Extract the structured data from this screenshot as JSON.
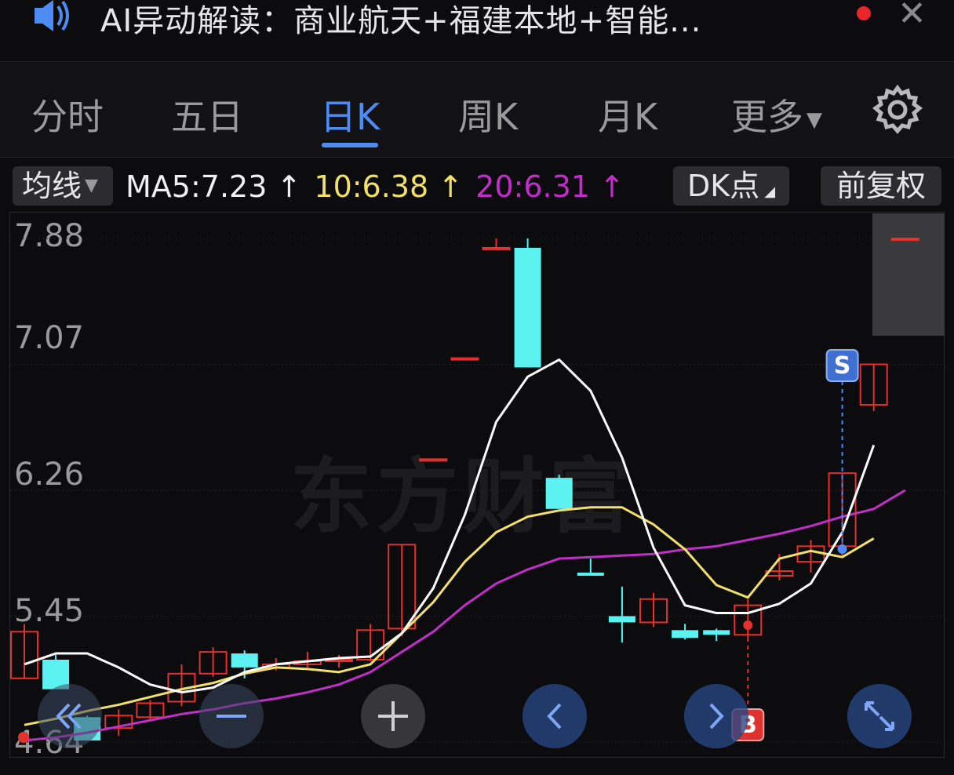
{
  "header": {
    "title": "AI异动解读：商业航天+福建本地+智能...",
    "speaker_icon": "speaker-icon",
    "close_icon": "close-icon",
    "notification_color": "#e8262c"
  },
  "tabs": [
    {
      "label": "分时",
      "active": false
    },
    {
      "label": "五日",
      "active": false
    },
    {
      "label": "日K",
      "active": true
    },
    {
      "label": "周K",
      "active": false
    },
    {
      "label": "月K",
      "active": false
    },
    {
      "label": "更多",
      "active": false
    }
  ],
  "toolbar": {
    "ma_selector": "均线",
    "ma5": "MA5:7.23 ↑",
    "ma10": "10:6.38 ↑",
    "ma20": "20:6.31 ↑",
    "dk_button": "DK点",
    "adjust_button": "前复权"
  },
  "colors": {
    "up": "#e0322f",
    "down": "#5df2f2",
    "ma5": "#ffffff",
    "ma10": "#f2e06a",
    "ma20": "#c02fc8",
    "accent": "#4d8cf5"
  },
  "chart": {
    "y_labels": [
      "7.88",
      "7.07",
      "6.26",
      "5.45",
      "4.64"
    ],
    "watermark": "东方财富",
    "signal_sell": "S",
    "signal_buy": "B"
  },
  "chart_data": {
    "type": "candlestick",
    "ylim": [
      4.64,
      7.88
    ],
    "y_ticks": [
      7.88,
      7.07,
      6.26,
      5.45,
      4.64
    ],
    "candles": [
      {
        "o": 5.05,
        "c": 5.35,
        "h": 5.4,
        "l": 5.05,
        "dir": "up"
      },
      {
        "o": 5.17,
        "c": 4.98,
        "h": 5.2,
        "l": 4.98,
        "dir": "down"
      },
      {
        "o": 4.8,
        "c": 4.65,
        "h": 4.81,
        "l": 4.65,
        "dir": "down"
      },
      {
        "o": 4.73,
        "c": 4.81,
        "h": 4.85,
        "l": 4.68,
        "dir": "up"
      },
      {
        "o": 4.8,
        "c": 4.89,
        "h": 4.91,
        "l": 4.78,
        "dir": "up"
      },
      {
        "o": 4.9,
        "c": 5.08,
        "h": 5.14,
        "l": 4.87,
        "dir": "up"
      },
      {
        "o": 5.08,
        "c": 5.22,
        "h": 5.25,
        "l": 5.06,
        "dir": "up"
      },
      {
        "o": 5.21,
        "c": 5.12,
        "h": 5.23,
        "l": 5.05,
        "dir": "down"
      },
      {
        "o": 5.12,
        "c": 5.14,
        "h": 5.18,
        "l": 5.1,
        "dir": "up"
      },
      {
        "o": 5.14,
        "c": 5.16,
        "h": 5.22,
        "l": 5.12,
        "dir": "up"
      },
      {
        "o": 5.16,
        "c": 5.17,
        "h": 5.2,
        "l": 5.12,
        "dir": "up"
      },
      {
        "o": 5.17,
        "c": 5.36,
        "h": 5.4,
        "l": 5.16,
        "dir": "up"
      },
      {
        "o": 5.37,
        "c": 5.91,
        "h": 5.91,
        "l": 5.32,
        "dir": "up"
      },
      {
        "o": 6.46,
        "c": 6.46,
        "h": 6.46,
        "l": 6.46,
        "dir": "up"
      },
      {
        "o": 7.11,
        "c": 7.11,
        "h": 7.11,
        "l": 7.11,
        "dir": "up"
      },
      {
        "o": 7.82,
        "c": 7.82,
        "h": 7.88,
        "l": 7.82,
        "dir": "up"
      },
      {
        "o": 7.82,
        "c": 7.05,
        "h": 7.88,
        "l": 7.05,
        "dir": "down"
      },
      {
        "o": 6.34,
        "c": 6.14,
        "h": 6.36,
        "l": 6.14,
        "dir": "down"
      },
      {
        "o": 5.73,
        "c": 5.71,
        "h": 5.82,
        "l": 5.71,
        "dir": "down"
      },
      {
        "o": 5.45,
        "c": 5.41,
        "h": 5.64,
        "l": 5.28,
        "dir": "down"
      },
      {
        "o": 5.41,
        "c": 5.56,
        "h": 5.6,
        "l": 5.38,
        "dir": "up"
      },
      {
        "o": 5.36,
        "c": 5.31,
        "h": 5.4,
        "l": 5.3,
        "dir": "down"
      },
      {
        "o": 5.36,
        "c": 5.33,
        "h": 5.37,
        "l": 5.29,
        "dir": "down"
      },
      {
        "o": 5.33,
        "c": 5.52,
        "h": 5.56,
        "l": 5.31,
        "dir": "up"
      },
      {
        "o": 5.71,
        "c": 5.74,
        "h": 5.85,
        "l": 5.68,
        "dir": "up"
      },
      {
        "o": 5.8,
        "c": 5.9,
        "h": 5.94,
        "l": 5.73,
        "dir": "up"
      },
      {
        "o": 5.9,
        "c": 6.37,
        "h": 6.37,
        "l": 5.84,
        "dir": "up"
      },
      {
        "o": 6.81,
        "c": 7.07,
        "h": 7.07,
        "l": 6.77,
        "dir": "up"
      },
      {
        "o": 7.88,
        "c": 7.88,
        "h": 7.88,
        "l": 7.88,
        "dir": "up"
      }
    ],
    "ma5": [
      5.14,
      5.21,
      5.21,
      5.12,
      5.01,
      4.96,
      4.99,
      5.09,
      5.14,
      5.16,
      5.18,
      5.19,
      5.34,
      5.63,
      6.1,
      6.7,
      6.99,
      7.1,
      6.9,
      6.47,
      5.89,
      5.52,
      5.47,
      5.47,
      5.53,
      5.66,
      5.99,
      6.55
    ],
    "ma10": [
      4.75,
      4.79,
      4.84,
      4.88,
      4.93,
      4.98,
      5.02,
      5.08,
      5.12,
      5.11,
      5.09,
      5.14,
      5.34,
      5.54,
      5.8,
      5.99,
      6.09,
      6.13,
      6.15,
      6.15,
      6.04,
      5.88,
      5.65,
      5.57,
      5.82,
      5.87,
      5.83,
      5.95
    ],
    "ma20": [
      4.65,
      4.67,
      4.7,
      4.74,
      4.78,
      4.82,
      4.85,
      4.89,
      4.92,
      4.96,
      5.01,
      5.09,
      5.22,
      5.35,
      5.52,
      5.66,
      5.75,
      5.82,
      5.83,
      5.84,
      5.85,
      5.88,
      5.9,
      5.94,
      5.98,
      6.03,
      6.09,
      6.14,
      6.26
    ]
  },
  "nav": {
    "buttons": [
      "rewind-icon",
      "zoom-out-icon",
      "zoom-in-icon",
      "prev-icon",
      "next-icon",
      "fullscreen-icon"
    ]
  }
}
